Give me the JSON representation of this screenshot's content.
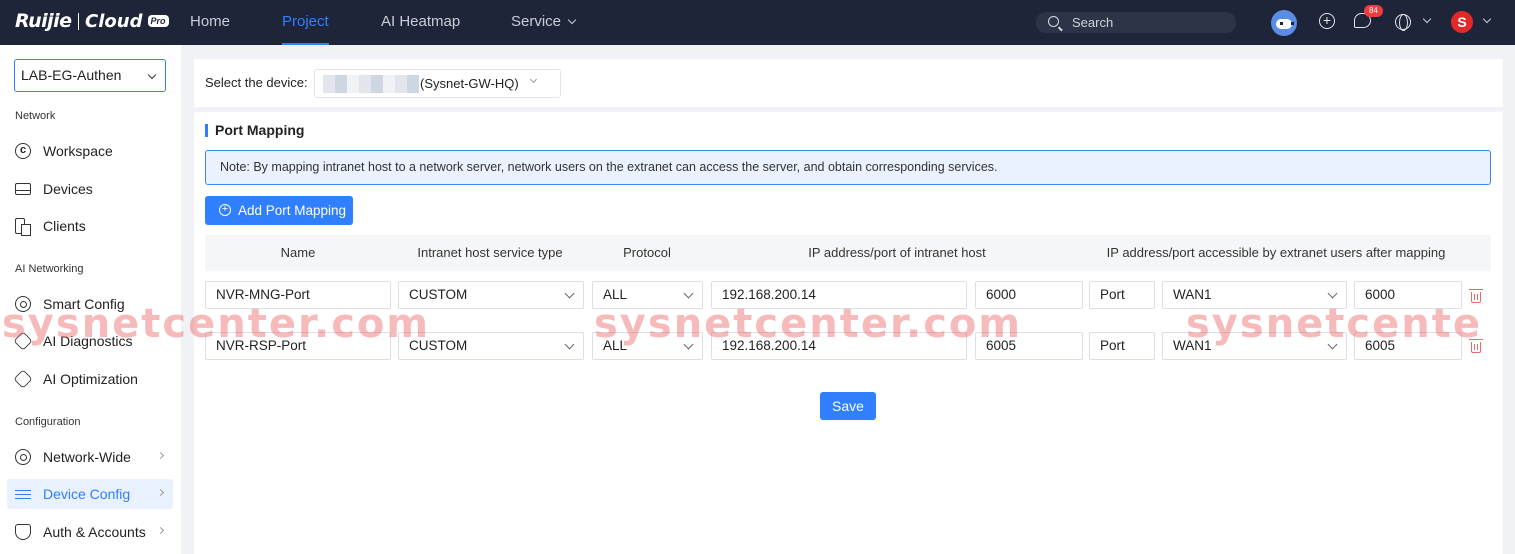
{
  "brand": {
    "name1": "Ruijie",
    "name2": "Cloud",
    "tag": "Pro"
  },
  "topnav": {
    "items": [
      "Home",
      "Project",
      "AI Heatmap",
      "Service"
    ],
    "search_placeholder": "Search",
    "notification_count": "84"
  },
  "user": {
    "avatar_letter": "S"
  },
  "sidebar": {
    "site": "LAB-EG-Authen",
    "sections": [
      "Network",
      "AI Networking",
      "Configuration"
    ],
    "items": [
      {
        "label": "Workspace",
        "icon": "workspace-icon"
      },
      {
        "label": "Devices",
        "icon": "devices-icon"
      },
      {
        "label": "Clients",
        "icon": "clients-icon"
      },
      {
        "label": "Smart Config",
        "icon": "smart-config-icon"
      },
      {
        "label": "AI Diagnostics",
        "icon": "ai-diagnostics-icon"
      },
      {
        "label": "AI Optimization",
        "icon": "ai-optimization-icon"
      },
      {
        "label": "Network-Wide",
        "icon": "gear-icon"
      },
      {
        "label": "Device Config",
        "icon": "sliders-icon"
      },
      {
        "label": "Auth & Accounts",
        "icon": "shield-icon"
      }
    ]
  },
  "device": {
    "label": "Select the device:",
    "name": "(Sysnet-GW-HQ)"
  },
  "port_mapping": {
    "title": "Port Mapping",
    "note": "Note: By mapping intranet host to a network server, network users on the extranet can access the server, and obtain corresponding services.",
    "add_button": "Add Port Mapping",
    "columns": [
      "Name",
      "Intranet host service type",
      "Protocol",
      "IP address/port of intranet host",
      "IP address/port accessible by extranet users after mapping"
    ],
    "rows": [
      {
        "name": "NVR-MNG-Port",
        "service_type": "CUSTOM",
        "protocol": "ALL",
        "intranet_ip": "192.168.200.14",
        "intranet_port": "6000",
        "ext_mode": "Port",
        "ext_interface": "WAN1",
        "ext_port": "6000"
      },
      {
        "name": "NVR-RSP-Port",
        "service_type": "CUSTOM",
        "protocol": "ALL",
        "intranet_ip": "192.168.200.14",
        "intranet_port": "6005",
        "ext_mode": "Port",
        "ext_interface": "WAN1",
        "ext_port": "6005"
      }
    ],
    "save_button": "Save"
  },
  "watermark": [
    "sysnetcenter.com",
    "sysnetcenter.com",
    "sysnetcente"
  ],
  "colors": {
    "accent": "#2f7fff",
    "topbar": "#1e2538",
    "danger": "#f03c3c"
  }
}
